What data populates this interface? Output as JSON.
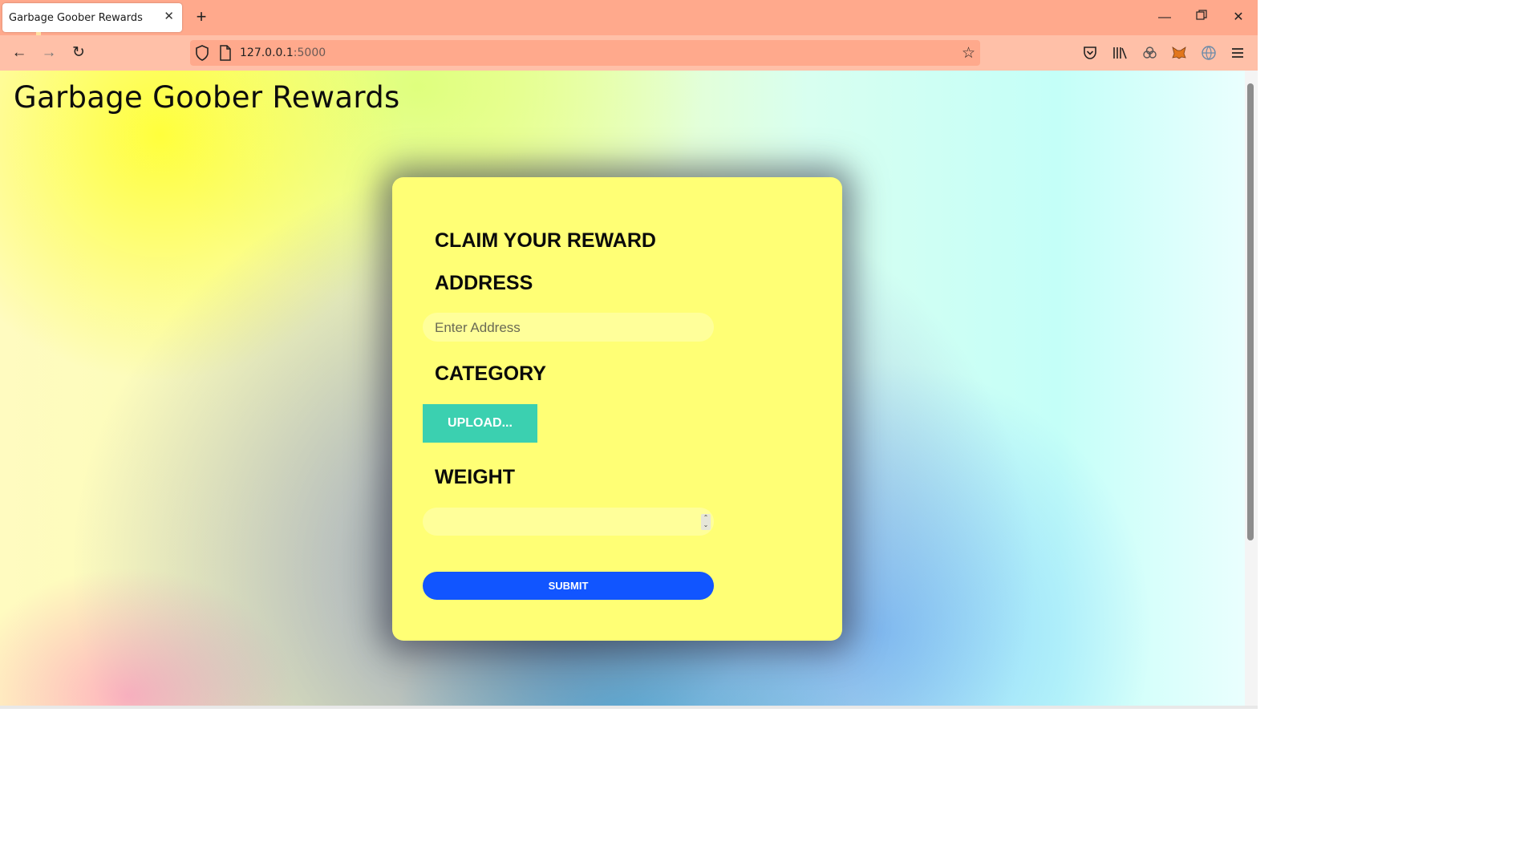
{
  "browser": {
    "tab_title": "Garbage Goober Rewards",
    "url_host": "127.0.0.1",
    "url_port": ":5000",
    "window_controls": [
      "minimize-icon",
      "restore-icon",
      "close-icon"
    ]
  },
  "page": {
    "title": "Garbage Goober Rewards"
  },
  "form": {
    "heading": "CLAIM YOUR REWARD",
    "address_label": "ADDRESS",
    "address_placeholder": "Enter Address",
    "category_label": "CATEGORY",
    "upload_label": "UPLOAD...",
    "weight_label": "WEIGHT",
    "weight_value": "",
    "submit_label": "SUBMIT"
  },
  "colors": {
    "card": "#ffff75",
    "upload_button": "#3bd0b0",
    "submit_button": "#1155ff",
    "tabbar": "#ffa98c"
  }
}
